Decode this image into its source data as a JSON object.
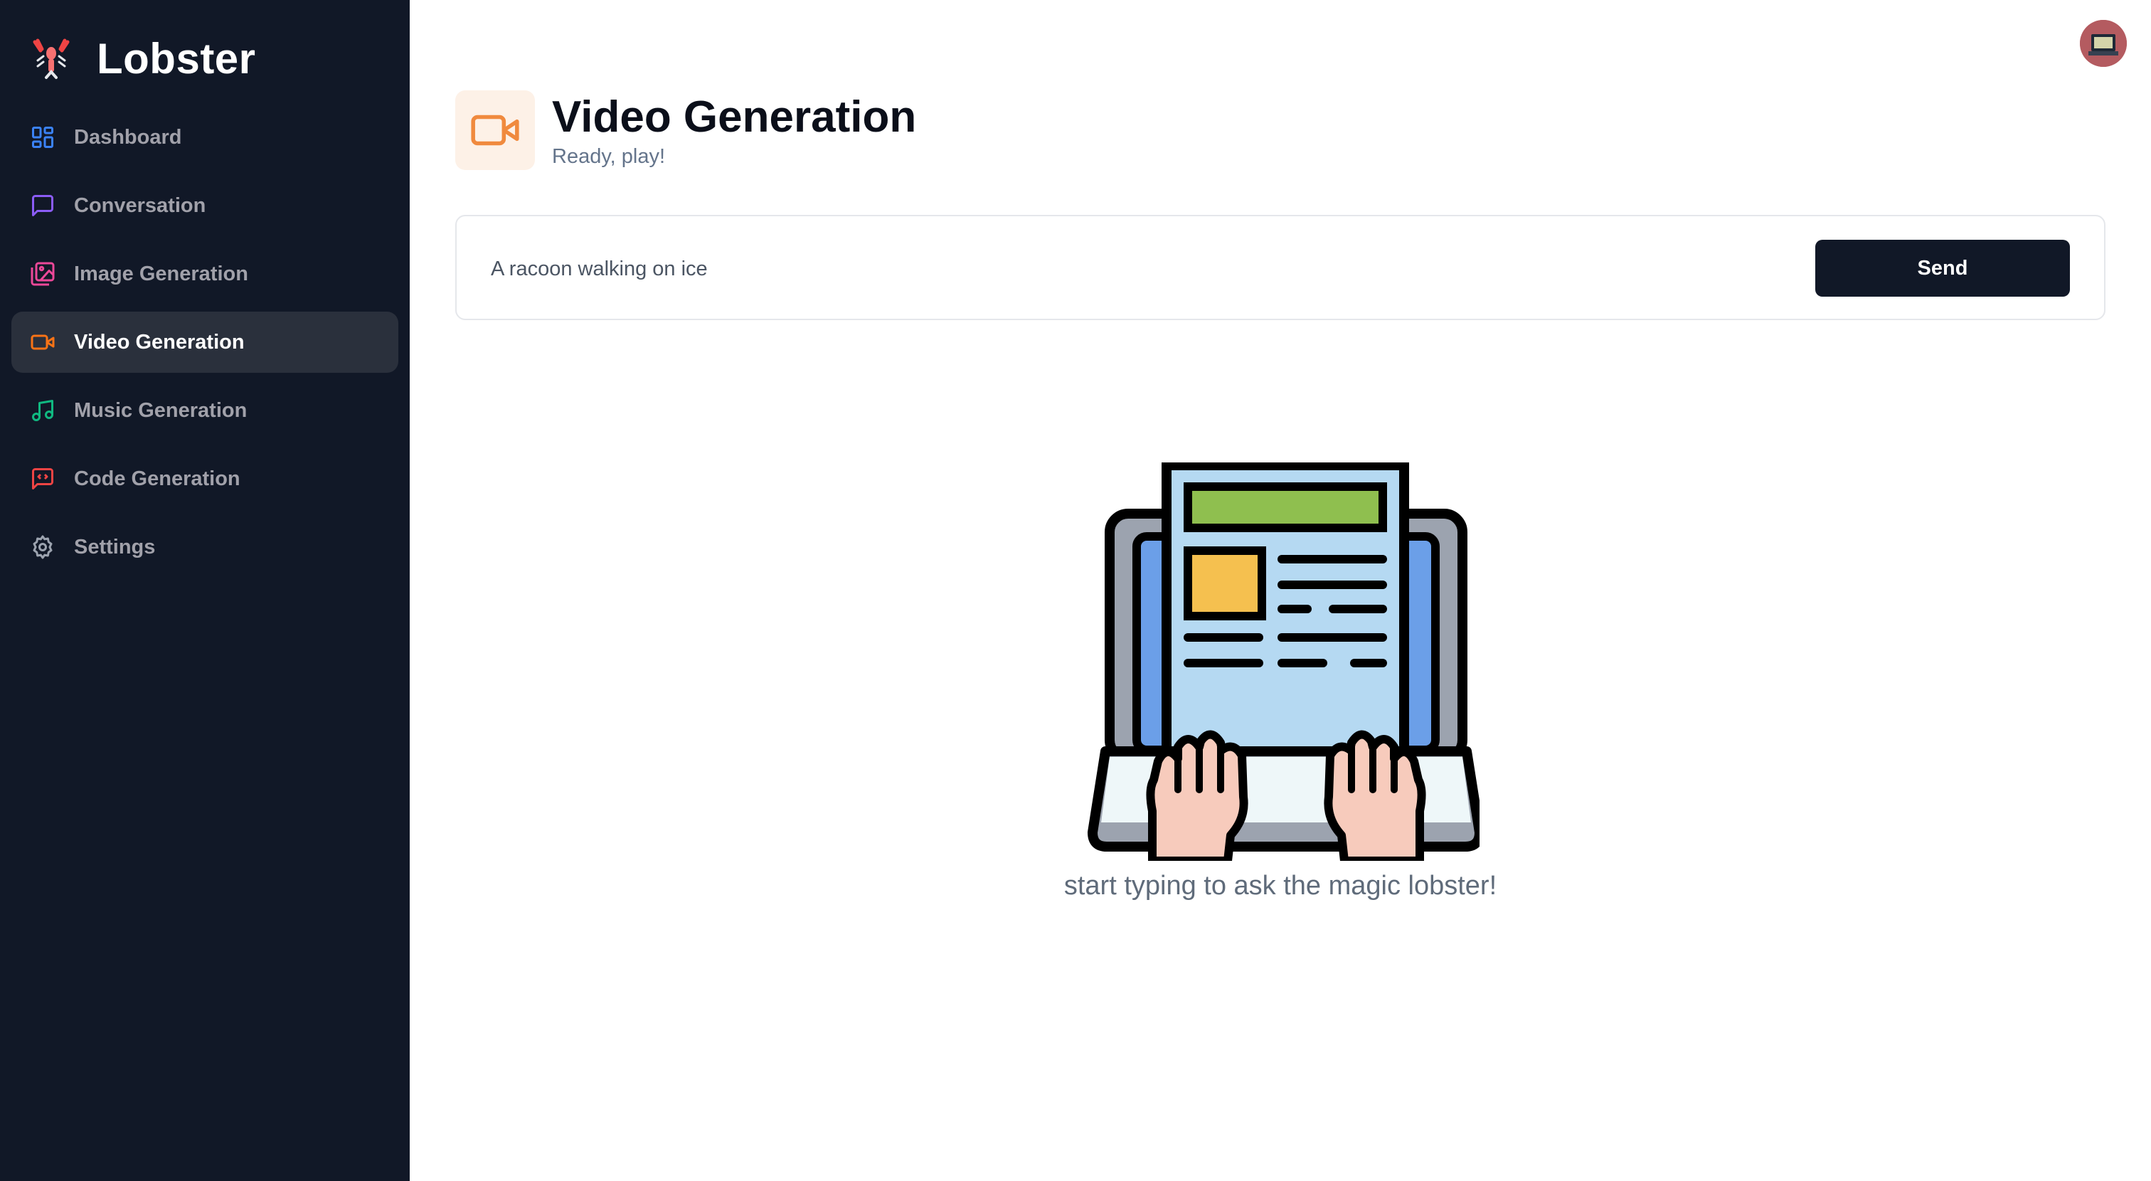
{
  "app": {
    "title": "Lobster"
  },
  "sidebar": {
    "items": [
      {
        "label": "Dashboard",
        "icon": "dashboard-icon",
        "color": "#3b82f6",
        "active": false
      },
      {
        "label": "Conversation",
        "icon": "message-icon",
        "color": "#8b5cf6",
        "active": false
      },
      {
        "label": "Image Generation",
        "icon": "image-icon",
        "color": "#ec4899",
        "active": false
      },
      {
        "label": "Video Generation",
        "icon": "video-icon",
        "color": "#f97316",
        "active": true
      },
      {
        "label": "Music Generation",
        "icon": "music-icon",
        "color": "#10b981",
        "active": false
      },
      {
        "label": "Code Generation",
        "icon": "code-icon",
        "color": "#ef4444",
        "active": false
      },
      {
        "label": "Settings",
        "icon": "gear-icon",
        "color": "#9ca3af",
        "active": false
      }
    ]
  },
  "header": {
    "title": "Video Generation",
    "subtitle": "Ready, play!",
    "accent": "#f97316"
  },
  "prompt": {
    "value": "A racoon walking on ice",
    "send_label": "Send"
  },
  "empty_state": {
    "text": "start typing to ask the magic lobster!"
  }
}
